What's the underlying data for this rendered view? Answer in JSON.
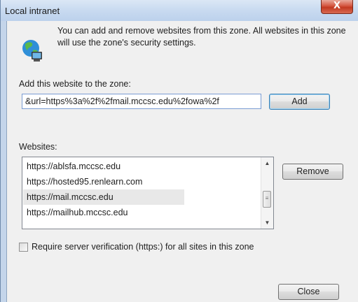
{
  "window": {
    "title": "Local intranet",
    "close_glyph": "X"
  },
  "intro": {
    "icon": "globe-computer-icon",
    "text": "You can add and remove websites from this zone. All websites in this zone will use the zone's security settings."
  },
  "add_section": {
    "label": "Add this website to the zone:",
    "url_value": "&url=https%3a%2f%2fmail.mccsc.edu%2fowa%2f",
    "add_button": "Add"
  },
  "websites": {
    "label": "Websites:",
    "items": [
      "https://ablsfa.mccsc.edu",
      "https://hosted95.renlearn.com",
      "https://mail.mccsc.edu",
      "https://mailhub.mccsc.edu"
    ],
    "selected_index": 2,
    "remove_button": "Remove"
  },
  "verification": {
    "checked": false,
    "label": "Require server verification (https:) for all sites in this zone"
  },
  "footer": {
    "close_button": "Close"
  }
}
